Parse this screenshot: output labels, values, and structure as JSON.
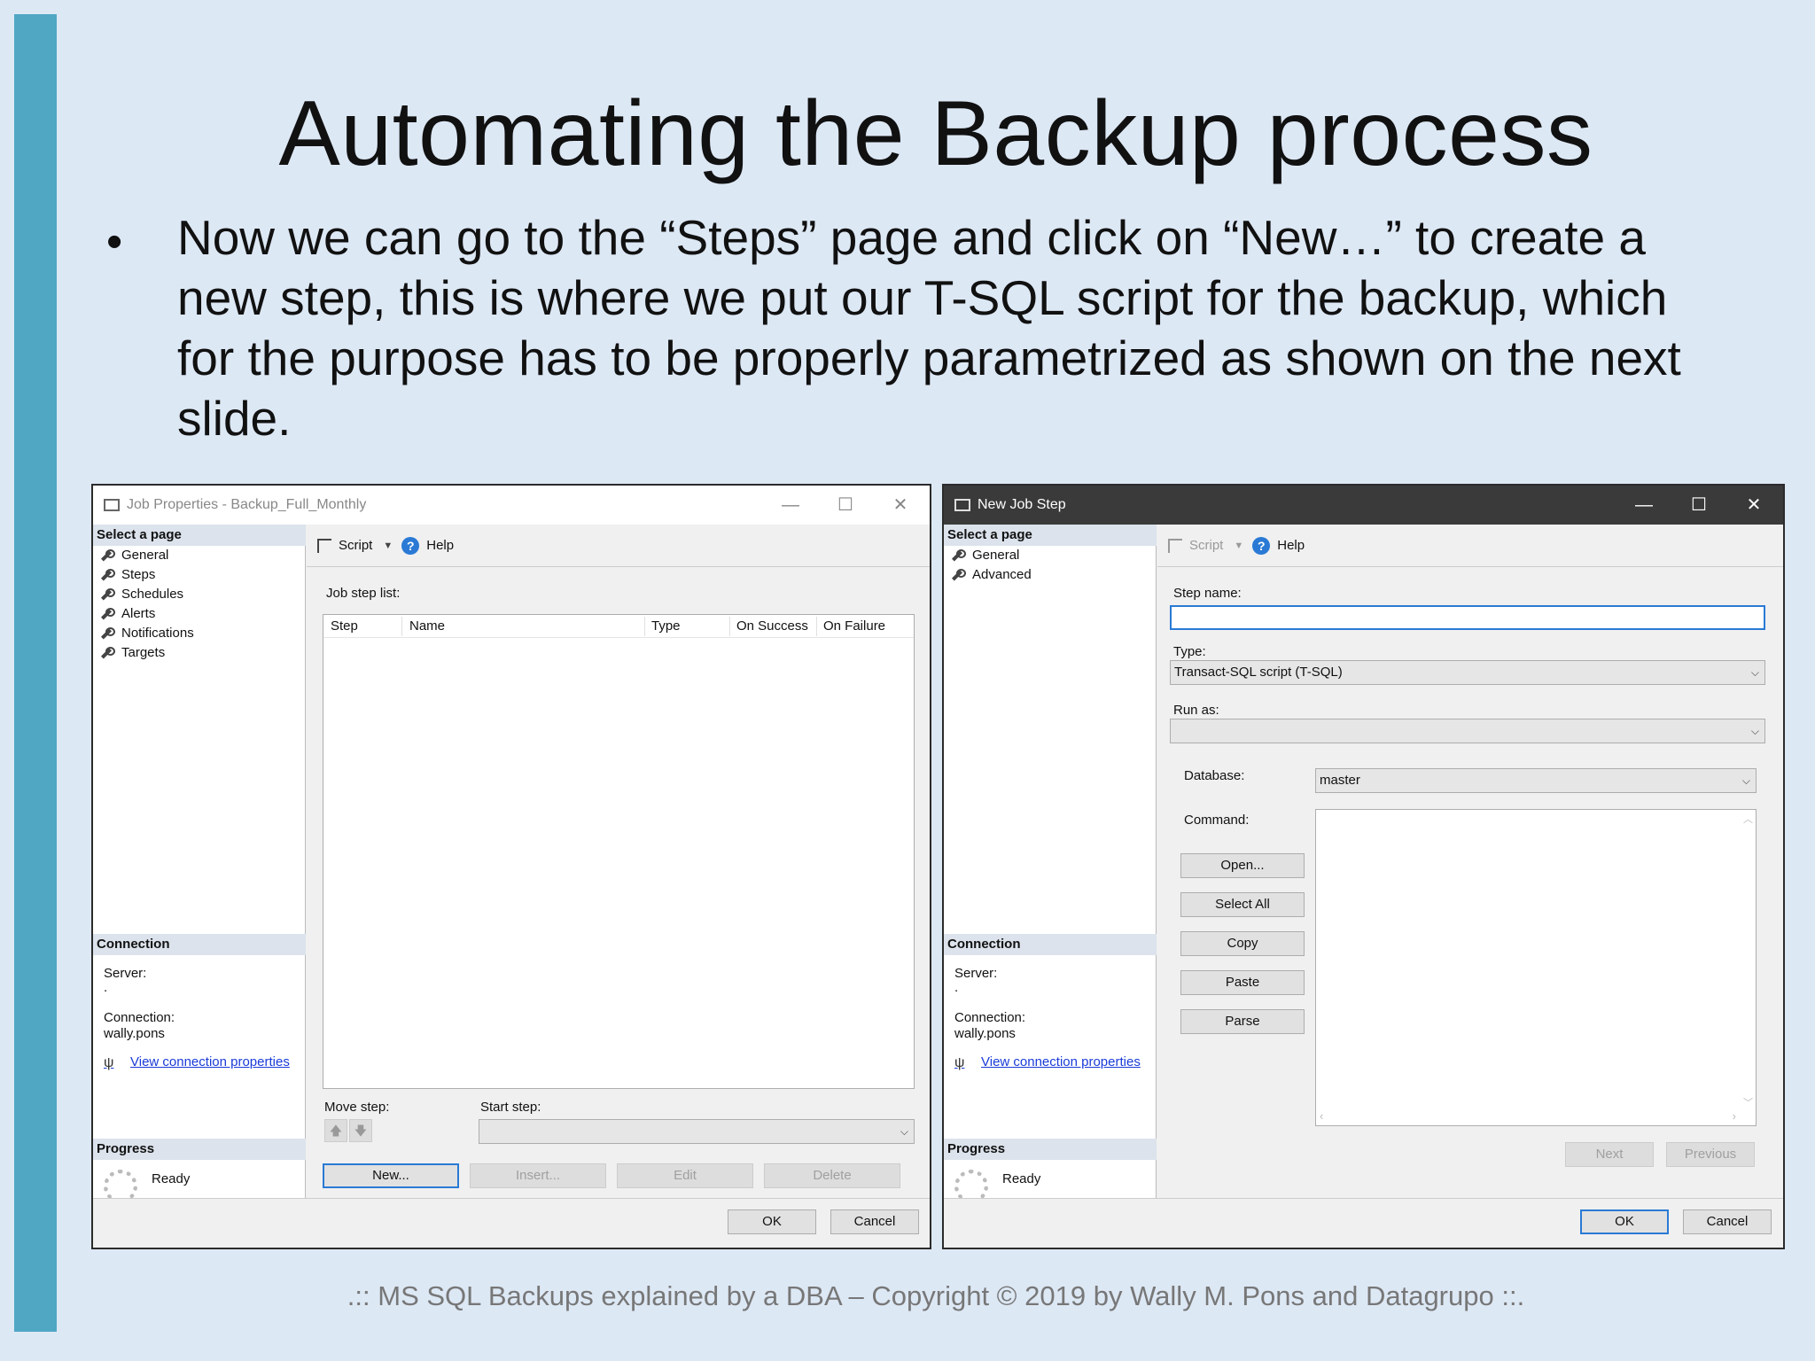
{
  "slide": {
    "title": "Automating the Backup process",
    "bullet": "Now we can go to the “Steps” page and click on “New…” to create a new step, this is where we put our T-SQL script for the backup, which for the purpose has to be properly parametrized as shown on the next slide.",
    "footer": ".:: MS SQL Backups explained by a DBA – Copyright © 2019 by Wally M. Pons and Datagrupo ::.",
    "accent_color": "#4fa7c4"
  },
  "job_properties": {
    "title": "Job Properties - Backup_Full_Monthly",
    "select_page": "Select a page",
    "pages": [
      "General",
      "Steps",
      "Schedules",
      "Alerts",
      "Notifications",
      "Targets"
    ],
    "connection_header": "Connection",
    "server_label": "Server:",
    "server_value": ".",
    "connection_label": "Connection:",
    "connection_value": "wally.pons",
    "view_connection": "View connection properties",
    "progress_header": "Progress",
    "progress_status": "Ready",
    "toolbar": {
      "script": "Script",
      "help": "Help"
    },
    "job_step_list_label": "Job step list:",
    "columns": [
      "Step",
      "Name",
      "Type",
      "On Success",
      "On Failure"
    ],
    "move_step_label": "Move step:",
    "start_step_label": "Start step:",
    "buttons": {
      "new": "New...",
      "insert": "Insert...",
      "edit": "Edit",
      "delete": "Delete",
      "ok": "OK",
      "cancel": "Cancel"
    }
  },
  "new_job_step": {
    "title": "New Job Step",
    "select_page": "Select a page",
    "pages": [
      "General",
      "Advanced"
    ],
    "connection_header": "Connection",
    "server_label": "Server:",
    "server_value": ".",
    "connection_label": "Connection:",
    "connection_value": "wally.pons",
    "view_connection": "View connection properties",
    "progress_header": "Progress",
    "progress_status": "Ready",
    "toolbar": {
      "script": "Script",
      "help": "Help"
    },
    "step_name_label": "Step name:",
    "step_name_value": "",
    "type_label": "Type:",
    "type_value": "Transact-SQL script (T-SQL)",
    "run_as_label": "Run as:",
    "run_as_value": "",
    "database_label": "Database:",
    "database_value": "master",
    "command_label": "Command:",
    "command_buttons": [
      "Open...",
      "Select All",
      "Copy",
      "Paste",
      "Parse"
    ],
    "buttons": {
      "next": "Next",
      "previous": "Previous",
      "ok": "OK",
      "cancel": "Cancel"
    }
  }
}
